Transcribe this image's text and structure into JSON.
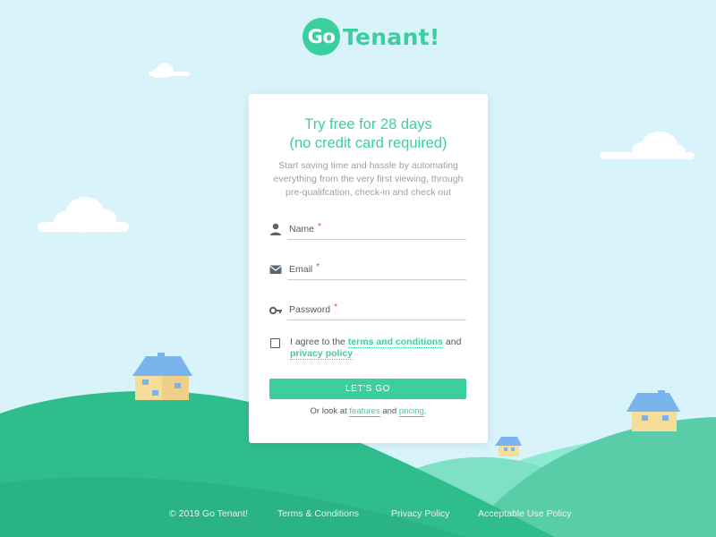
{
  "brand": {
    "badge": "Go",
    "name": "Tenant!"
  },
  "colors": {
    "accent": "#3bcf9f",
    "sky": "#d9f3fb",
    "required": "#e64646"
  },
  "card": {
    "title_line1": "Try free for 28 days",
    "title_line2": "(no credit card required)",
    "subtitle": "Start saving time and hassle by automating everything from the very first viewing, through pre-qualifcation, check-in and check out"
  },
  "form": {
    "name": {
      "label": "Name",
      "required_mark": "*",
      "value": "",
      "icon": "person-icon"
    },
    "email": {
      "label": "Email",
      "required_mark": "*",
      "value": "",
      "icon": "envelope-icon"
    },
    "password": {
      "label": "Password",
      "required_mark": "*",
      "value": "",
      "icon": "key-icon"
    },
    "agree": {
      "checked": false,
      "prefix": "I agree to the",
      "terms_link": "terms and conditions",
      "middle": "and",
      "privacy_link": "privacy policy"
    },
    "submit_label": "LET'S GO",
    "or_prefix": "Or look at",
    "features_link": "features",
    "or_middle": "and",
    "pricing_link": "pricing",
    "or_suffix": "."
  },
  "footer": {
    "copyright": "© 2019 Go Tenant!",
    "links": [
      "Terms & Conditions",
      "Privacy Policy",
      "Acceptable Use Policy"
    ]
  }
}
